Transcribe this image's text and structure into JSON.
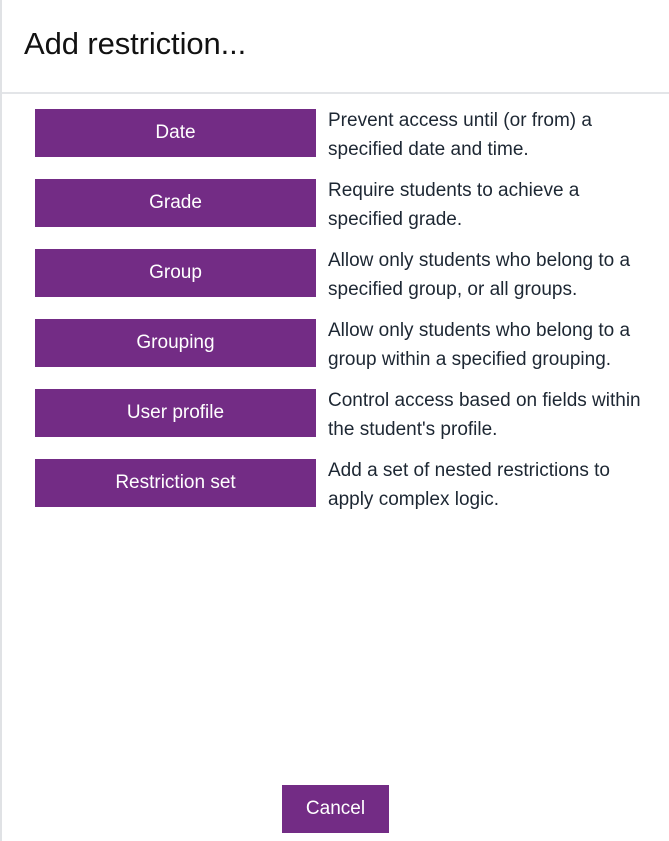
{
  "dialog": {
    "title": "Add restriction...",
    "accent_color": "#732c85",
    "button_text_color": "#ffffff",
    "description_color": "#1d2733",
    "divider_color": "#e3e5e8"
  },
  "restrictions": [
    {
      "label": "Date",
      "description": "Prevent access until (or from) a specified date and time."
    },
    {
      "label": "Grade",
      "description": "Require students to achieve a specified grade."
    },
    {
      "label": "Group",
      "description": "Allow only students who belong to a specified group, or all groups."
    },
    {
      "label": "Grouping",
      "description": "Allow only students who belong to a group within a specified grouping."
    },
    {
      "label": "User profile",
      "description": "Control access based on fields within the student's profile."
    },
    {
      "label": "Restriction set",
      "description": "Add a set of nested restrictions to apply complex logic."
    }
  ],
  "footer": {
    "cancel_label": "Cancel"
  }
}
